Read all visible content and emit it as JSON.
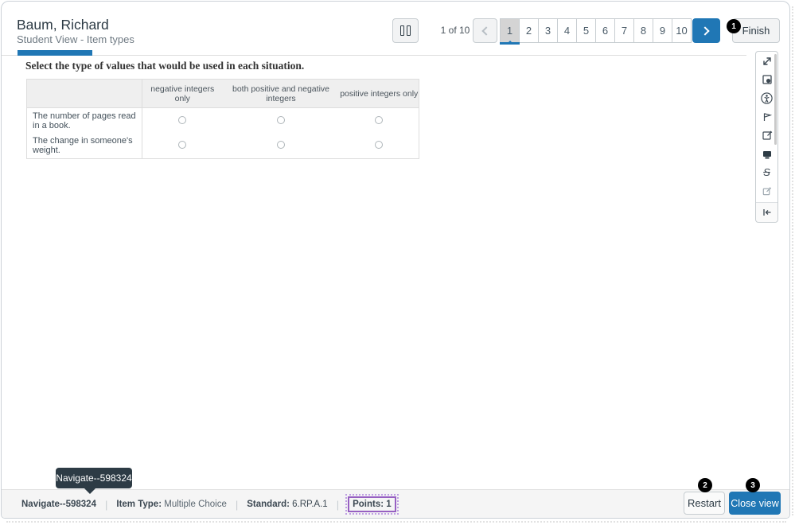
{
  "colors": {
    "accent": "#2077b5",
    "tooltip_bg": "#2d3b45",
    "badge_bg": "#000000",
    "purple": "#9760c2"
  },
  "header": {
    "student_name": "Baum, Richard",
    "subtitle": "Student View - Item types"
  },
  "pagination": {
    "counter": "1 of 10",
    "pages": [
      "1",
      "2",
      "3",
      "4",
      "5",
      "6",
      "7",
      "8",
      "9",
      "10"
    ],
    "active_page": "1",
    "finish_label": "Finish",
    "finish_badge": "1"
  },
  "progress": {
    "percent_complete": 10
  },
  "question": {
    "prompt": "Select the type of values that would be used in each situation."
  },
  "answer_table": {
    "columns": [
      "negative integers only",
      "both positive and negative integers",
      "positive integers only"
    ],
    "rows": [
      "The number of pages read in a book.",
      "The change in someone's weight."
    ]
  },
  "toolbar": {
    "icons": [
      "expand-icon",
      "zoom-page-icon",
      "accessibility-icon",
      "flag-icon",
      "notes-icon",
      "screen-icon",
      "strikethrough-icon",
      "eliminator-icon",
      "collapse-left-icon"
    ]
  },
  "tooltip": {
    "text": "Navigate--598324"
  },
  "footer": {
    "item_id": "Navigate--598324",
    "item_type_label": "Item Type:",
    "item_type_value": "Multiple Choice",
    "standard_label": "Standard:",
    "standard_value": "6.RP.A.1",
    "points_label": "Points: 1",
    "restart_label": "Restart",
    "restart_badge": "2",
    "close_label": "Close view",
    "close_badge": "3"
  }
}
